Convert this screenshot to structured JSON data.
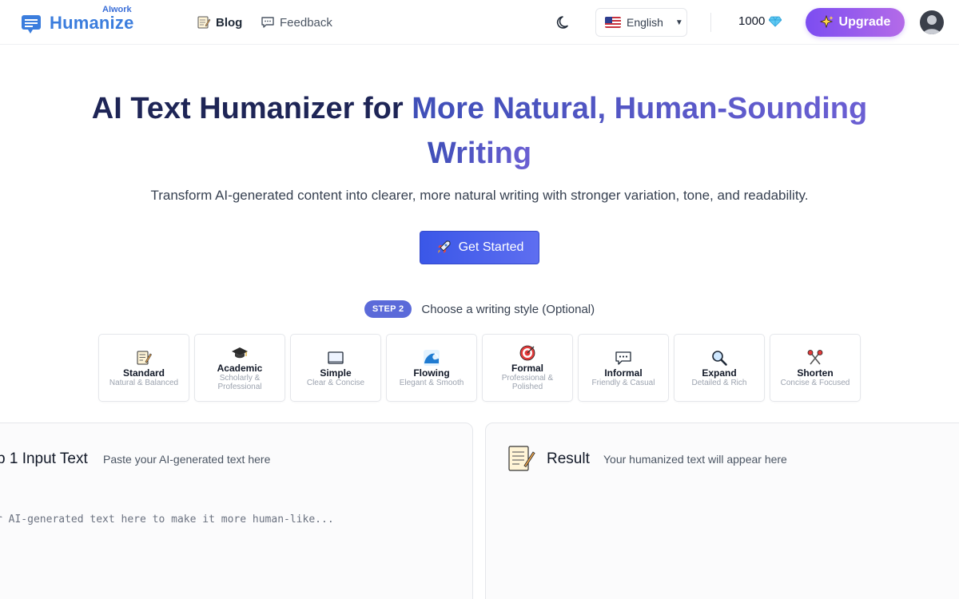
{
  "header": {
    "logo_small": "AIwork",
    "logo_text": "Humanize",
    "nav": {
      "blog": "Blog",
      "feedback": "Feedback"
    },
    "language": "English",
    "credits": "1000",
    "upgrade_label": "Upgrade"
  },
  "hero": {
    "title_dark": "AI Text Humanizer for ",
    "title_accent": "More Natural, Human-Sounding",
    "title_line2": "Writing",
    "subtitle": "Transform AI-generated content into clearer, more natural writing with stronger variation, tone, and readability.",
    "cta_label": "Get Started"
  },
  "step2": {
    "badge": "STEP 2",
    "text": "Choose a writing style (Optional)",
    "styles": [
      {
        "name": "Standard",
        "desc": "Natural & Balanced",
        "icon": "memo-icon"
      },
      {
        "name": "Academic",
        "desc": "Scholarly & Professional",
        "icon": "graduation-cap-icon"
      },
      {
        "name": "Simple",
        "desc": "Clear & Concise",
        "icon": "book-icon"
      },
      {
        "name": "Flowing",
        "desc": "Elegant & Smooth",
        "icon": "wave-icon"
      },
      {
        "name": "Formal",
        "desc": "Professional & Polished",
        "icon": "target-icon"
      },
      {
        "name": "Informal",
        "desc": "Friendly & Casual",
        "icon": "chat-bubble-icon"
      },
      {
        "name": "Expand",
        "desc": "Detailed & Rich",
        "icon": "magnifier-icon"
      },
      {
        "name": "Shorten",
        "desc": "Concise & Focused",
        "icon": "scissors-icon"
      }
    ]
  },
  "input_panel": {
    "title": "p 1 Input Text",
    "hint": "Paste your AI-generated text here",
    "placeholder": "r AI-generated text here to make it more human-like..."
  },
  "result_panel": {
    "title": "Result",
    "hint": "Your humanized text will appear here"
  }
}
